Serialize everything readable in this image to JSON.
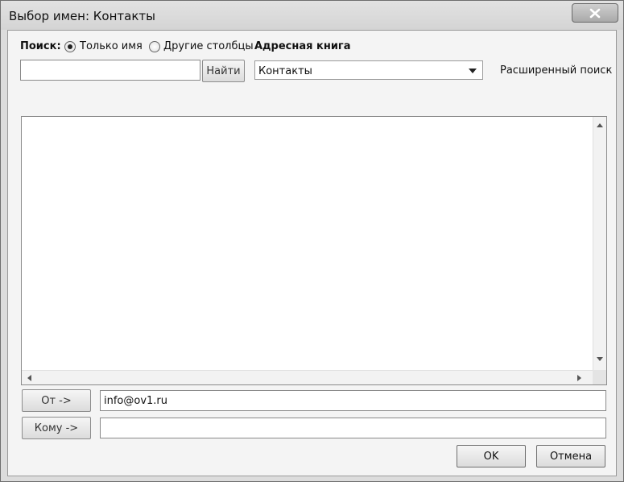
{
  "window": {
    "title": "Выбор имен: Контакты"
  },
  "search": {
    "label": "Поиск:",
    "option_name_only": "Только имя",
    "option_other_columns": "Другие столбцы",
    "query": "",
    "find_label": "Найти",
    "selected_option": "Только имя"
  },
  "address_book": {
    "label": "Адресная книга",
    "selected": "Контакты",
    "advanced_search": "Расширенный поиск"
  },
  "recipients": {
    "from_label": "От ->",
    "from_value": "info@ov1.ru",
    "to_label": "Кому ->",
    "to_value": ""
  },
  "footer": {
    "ok_label": "OK",
    "cancel_label": "Отмена"
  },
  "icons": {
    "close": "close-icon",
    "dropdown": "chevron-down-icon",
    "scroll_up": "arrow-up-icon",
    "scroll_down": "arrow-down-icon",
    "scroll_left": "arrow-left-icon",
    "scroll_right": "arrow-right-icon"
  }
}
